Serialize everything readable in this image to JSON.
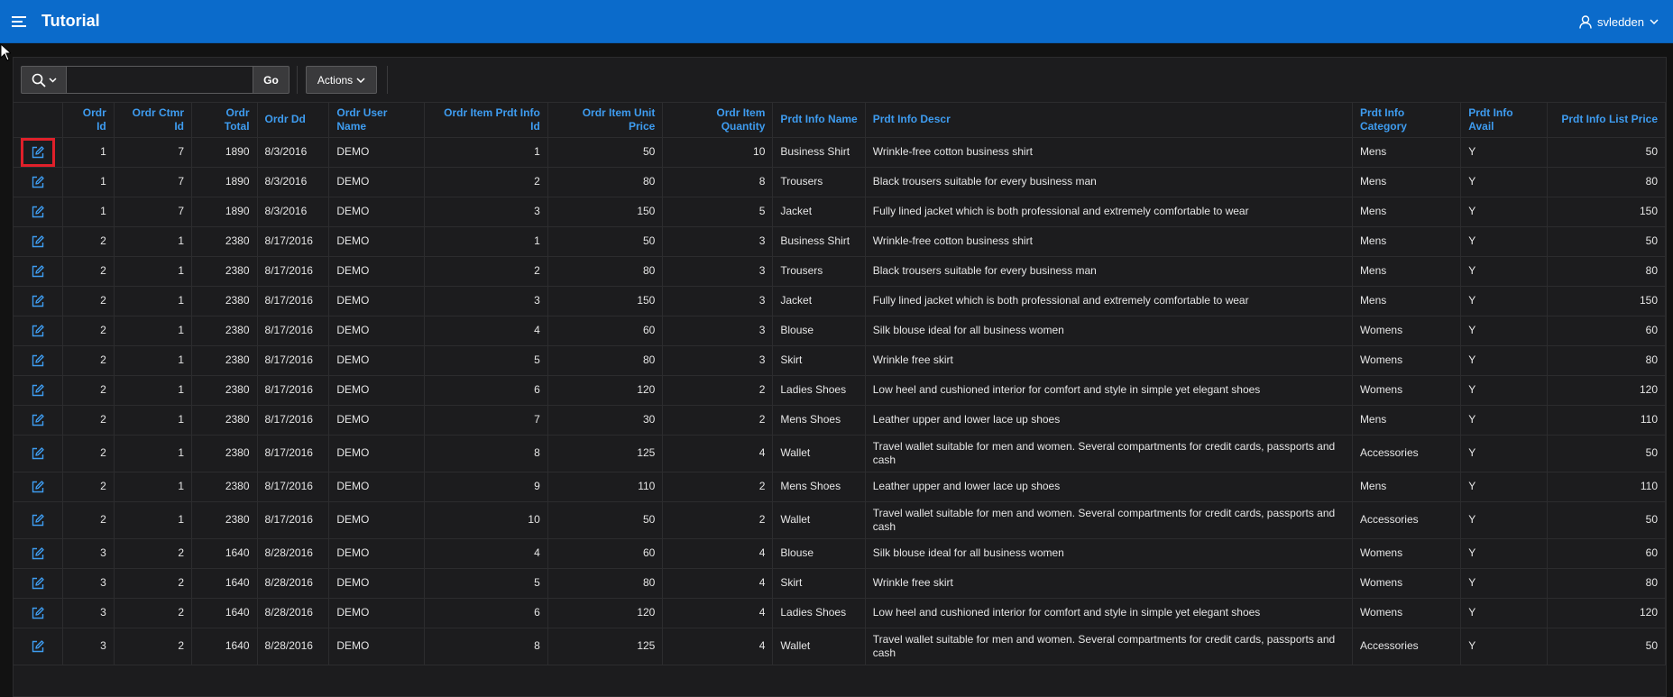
{
  "app": {
    "title": "Tutorial",
    "user": "svledden"
  },
  "toolbar": {
    "search_value": "",
    "go_label": "Go",
    "actions_label": "Actions"
  },
  "columns": [
    "",
    "Ordr Id",
    "Ordr Ctmr Id",
    "Ordr Total",
    "Ordr Dd",
    "Ordr User Name",
    "Ordr Item Prdt Info Id",
    "Ordr Item Unit Price",
    "Ordr Item Quantity",
    "Prdt Info Name",
    "Prdt Info Descr",
    "Prdt Info Category",
    "Prdt Info Avail",
    "Prdt Info List Price"
  ],
  "rows": [
    [
      "1",
      "7",
      "1890",
      "8/3/2016",
      "DEMO",
      "1",
      "50",
      "10",
      "Business Shirt",
      "Wrinkle-free cotton business shirt",
      "Mens",
      "Y",
      "50"
    ],
    [
      "1",
      "7",
      "1890",
      "8/3/2016",
      "DEMO",
      "2",
      "80",
      "8",
      "Trousers",
      "Black trousers suitable for every business man",
      "Mens",
      "Y",
      "80"
    ],
    [
      "1",
      "7",
      "1890",
      "8/3/2016",
      "DEMO",
      "3",
      "150",
      "5",
      "Jacket",
      "Fully lined jacket which is both professional and extremely comfortable to wear",
      "Mens",
      "Y",
      "150"
    ],
    [
      "2",
      "1",
      "2380",
      "8/17/2016",
      "DEMO",
      "1",
      "50",
      "3",
      "Business Shirt",
      "Wrinkle-free cotton business shirt",
      "Mens",
      "Y",
      "50"
    ],
    [
      "2",
      "1",
      "2380",
      "8/17/2016",
      "DEMO",
      "2",
      "80",
      "3",
      "Trousers",
      "Black trousers suitable for every business man",
      "Mens",
      "Y",
      "80"
    ],
    [
      "2",
      "1",
      "2380",
      "8/17/2016",
      "DEMO",
      "3",
      "150",
      "3",
      "Jacket",
      "Fully lined jacket which is both professional and extremely comfortable to wear",
      "Mens",
      "Y",
      "150"
    ],
    [
      "2",
      "1",
      "2380",
      "8/17/2016",
      "DEMO",
      "4",
      "60",
      "3",
      "Blouse",
      "Silk blouse ideal for all business women",
      "Womens",
      "Y",
      "60"
    ],
    [
      "2",
      "1",
      "2380",
      "8/17/2016",
      "DEMO",
      "5",
      "80",
      "3",
      "Skirt",
      "Wrinkle free skirt",
      "Womens",
      "Y",
      "80"
    ],
    [
      "2",
      "1",
      "2380",
      "8/17/2016",
      "DEMO",
      "6",
      "120",
      "2",
      "Ladies Shoes",
      "Low heel and cushioned interior for comfort and style in simple yet elegant shoes",
      "Womens",
      "Y",
      "120"
    ],
    [
      "2",
      "1",
      "2380",
      "8/17/2016",
      "DEMO",
      "7",
      "30",
      "2",
      "Mens Shoes",
      "Leather upper and lower lace up shoes",
      "Mens",
      "Y",
      "110"
    ],
    [
      "2",
      "1",
      "2380",
      "8/17/2016",
      "DEMO",
      "8",
      "125",
      "4",
      "Wallet",
      "Travel wallet suitable for men and women. Several compartments for credit cards, passports and cash",
      "Accessories",
      "Y",
      "50"
    ],
    [
      "2",
      "1",
      "2380",
      "8/17/2016",
      "DEMO",
      "9",
      "110",
      "2",
      "Mens Shoes",
      "Leather upper and lower lace up shoes",
      "Mens",
      "Y",
      "110"
    ],
    [
      "2",
      "1",
      "2380",
      "8/17/2016",
      "DEMO",
      "10",
      "50",
      "2",
      "Wallet",
      "Travel wallet suitable for men and women. Several compartments for credit cards, passports and cash",
      "Accessories",
      "Y",
      "50"
    ],
    [
      "3",
      "2",
      "1640",
      "8/28/2016",
      "DEMO",
      "4",
      "60",
      "4",
      "Blouse",
      "Silk blouse ideal for all business women",
      "Womens",
      "Y",
      "60"
    ],
    [
      "3",
      "2",
      "1640",
      "8/28/2016",
      "DEMO",
      "5",
      "80",
      "4",
      "Skirt",
      "Wrinkle free skirt",
      "Womens",
      "Y",
      "80"
    ],
    [
      "3",
      "2",
      "1640",
      "8/28/2016",
      "DEMO",
      "6",
      "120",
      "4",
      "Ladies Shoes",
      "Low heel and cushioned interior for comfort and style in simple yet elegant shoes",
      "Womens",
      "Y",
      "120"
    ],
    [
      "3",
      "2",
      "1640",
      "8/28/2016",
      "DEMO",
      "8",
      "125",
      "4",
      "Wallet",
      "Travel wallet suitable for men and women. Several compartments for credit cards, passports and cash",
      "Accessories",
      "Y",
      "50"
    ]
  ],
  "icons": {
    "menu": "hamburger-icon",
    "user": "user-icon",
    "search": "search-icon",
    "edit": "edit-icon"
  },
  "colors": {
    "header_bg": "#0b6bcb",
    "page_bg": "#121212",
    "region_bg": "#1c1c1e",
    "header_text": "#3e9cf0",
    "highlight": "#e0202a"
  }
}
